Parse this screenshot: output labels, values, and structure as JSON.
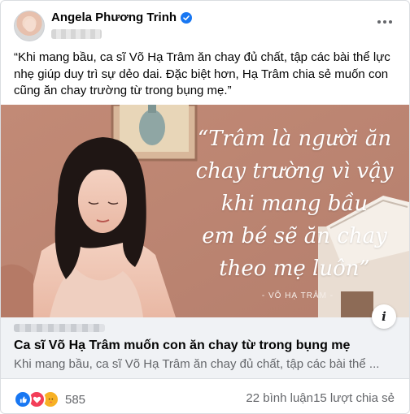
{
  "post": {
    "author": "Angela Phương Trinh",
    "text": "“Khi mang bầu, ca sĩ Võ Hạ Trâm ăn chay đủ chất, tập các bài thể lực nhẹ giúp duy trì sự dẻo dai. Đặc biệt hơn, Hạ Trâm chia sẻ muốn con cũng ăn chay trường từ trong bụng mẹ.”"
  },
  "link": {
    "image_quote_lines": [
      "“Trâm là người ăn",
      "chay trường vì vậy",
      "khi mang bầu",
      "em bé sẽ ăn chay",
      "theo mẹ luôn”"
    ],
    "image_quote_source": "- VÕ HẠ TRÂM -",
    "info_icon": "i",
    "title": "Ca sĩ Võ Hạ Trâm muốn con ăn chay từ trong bụng mẹ",
    "description": "Khi mang bầu, ca sĩ Võ Hạ Trâm ăn chay đủ chất, tập các bài thể ..."
  },
  "stats": {
    "reaction_icons": [
      "like-icon",
      "love-icon",
      "care-icon"
    ],
    "reaction_count": "585",
    "comments": "22 bình luận",
    "shares": "15 lượt chia sẻ"
  },
  "colors": {
    "accent": "#1877f2",
    "secondary_text": "#65676b",
    "link_bg": "#f0f2f5"
  }
}
